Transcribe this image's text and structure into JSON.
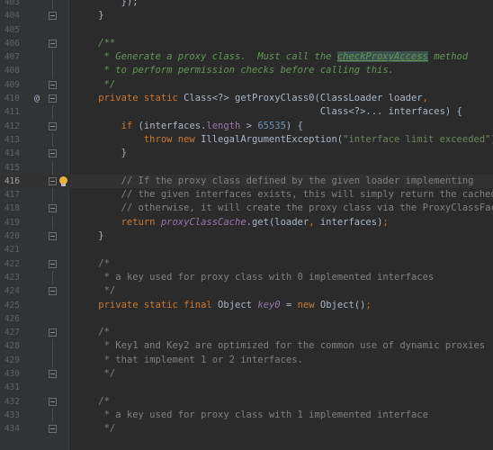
{
  "theme": {
    "background": "#2b2b2b",
    "gutter": "#313335",
    "keyword": "#cc7832",
    "number": "#6897bb",
    "string": "#6a8759",
    "comment": "#808080",
    "doc_comment": "#629755",
    "field": "#9876aa",
    "text": "#a9b7c6"
  },
  "lines": [
    {
      "n": "403",
      "tokens": [
        {
          "c": "plain",
          "t": "        });"
        }
      ],
      "fold": "vline"
    },
    {
      "n": "404",
      "tokens": [
        {
          "c": "plain",
          "t": "    }"
        }
      ],
      "fold": "rect"
    },
    {
      "n": "405",
      "tokens": [],
      "fold": ""
    },
    {
      "n": "406",
      "tokens": [
        {
          "c": "dc",
          "t": "    /**"
        }
      ],
      "fold": "rect"
    },
    {
      "n": "407",
      "tokens": [
        {
          "c": "dc",
          "t": "     * Generate a proxy class.  Must call the "
        },
        {
          "c": "dc-hl",
          "t": "checkProxyAccess"
        },
        {
          "c": "dc",
          "t": " method"
        }
      ],
      "fold": "vline"
    },
    {
      "n": "408",
      "tokens": [
        {
          "c": "dc",
          "t": "     * to perform permission checks before calling this."
        }
      ],
      "fold": "vline"
    },
    {
      "n": "409",
      "tokens": [
        {
          "c": "dc",
          "t": "     */"
        }
      ],
      "fold": "rect"
    },
    {
      "n": "410",
      "mark": "@",
      "tokens": [
        {
          "c": "kw",
          "t": "    private static "
        },
        {
          "c": "plain",
          "t": "Class<?> getProxyClass0(ClassLoader loader"
        },
        {
          "c": "kw",
          "t": ","
        }
      ],
      "fold": "rect"
    },
    {
      "n": "411",
      "tokens": [
        {
          "c": "plain",
          "t": "                                           Class<?>... interfaces) {"
        }
      ],
      "fold": "vline"
    },
    {
      "n": "412",
      "tokens": [
        {
          "c": "kw",
          "t": "        if "
        },
        {
          "c": "plain",
          "t": "(interfaces."
        },
        {
          "c": "field",
          "t": "length"
        },
        {
          "c": "plain",
          "t": " > "
        },
        {
          "c": "num",
          "t": "65535"
        },
        {
          "c": "plain",
          "t": ") {"
        }
      ],
      "fold": "rect"
    },
    {
      "n": "413",
      "tokens": [
        {
          "c": "kw",
          "t": "            throw new "
        },
        {
          "c": "plain",
          "t": "IllegalArgumentException("
        },
        {
          "c": "str",
          "t": "\"interface limit exceeded\""
        },
        {
          "c": "plain",
          "t": ")"
        },
        {
          "c": "kw",
          "t": ";"
        }
      ],
      "fold": "vline"
    },
    {
      "n": "414",
      "tokens": [
        {
          "c": "plain",
          "t": "        }"
        }
      ],
      "fold": "rect"
    },
    {
      "n": "415",
      "tokens": [],
      "fold": "vline"
    },
    {
      "n": "416",
      "current": true,
      "bulb": true,
      "tokens": [
        {
          "c": "cm",
          "t": "        // If the proxy class defined by the given loader implementing"
        }
      ],
      "fold": "rect"
    },
    {
      "n": "417",
      "tokens": [
        {
          "c": "cm",
          "t": "        // the given interfaces exists, this will simply return the cached copy;"
        }
      ],
      "fold": "vline"
    },
    {
      "n": "418",
      "tokens": [
        {
          "c": "cm",
          "t": "        // otherwise, it will create the proxy class via the ProxyClassFactory"
        }
      ],
      "fold": "rect"
    },
    {
      "n": "419",
      "tokens": [
        {
          "c": "kw",
          "t": "        return "
        },
        {
          "c": "sfield",
          "t": "proxyClassCache"
        },
        {
          "c": "plain",
          "t": ".get(loader"
        },
        {
          "c": "kw",
          "t": ", "
        },
        {
          "c": "plain",
          "t": "interfaces)"
        },
        {
          "c": "kw",
          "t": ";"
        }
      ],
      "fold": "vline"
    },
    {
      "n": "420",
      "tokens": [
        {
          "c": "plain",
          "t": "    }"
        }
      ],
      "fold": "rect"
    },
    {
      "n": "421",
      "tokens": [],
      "fold": ""
    },
    {
      "n": "422",
      "tokens": [
        {
          "c": "cm",
          "t": "    /*"
        }
      ],
      "fold": "rect"
    },
    {
      "n": "423",
      "tokens": [
        {
          "c": "cm",
          "t": "     * a key used for proxy class with 0 implemented interfaces"
        }
      ],
      "fold": "vline"
    },
    {
      "n": "424",
      "tokens": [
        {
          "c": "cm",
          "t": "     */"
        }
      ],
      "fold": "rect"
    },
    {
      "n": "425",
      "tokens": [
        {
          "c": "kw",
          "t": "    private static final "
        },
        {
          "c": "plain",
          "t": "Object "
        },
        {
          "c": "sfield",
          "t": "key0"
        },
        {
          "c": "plain",
          "t": " = "
        },
        {
          "c": "kw",
          "t": "new "
        },
        {
          "c": "plain",
          "t": "Object()"
        },
        {
          "c": "kw",
          "t": ";"
        }
      ],
      "fold": ""
    },
    {
      "n": "426",
      "tokens": [],
      "fold": ""
    },
    {
      "n": "427",
      "tokens": [
        {
          "c": "cm",
          "t": "    /*"
        }
      ],
      "fold": "rect"
    },
    {
      "n": "428",
      "tokens": [
        {
          "c": "cm",
          "t": "     * Key1 and Key2 are optimized for the common use of dynamic proxies"
        }
      ],
      "fold": "vline"
    },
    {
      "n": "429",
      "tokens": [
        {
          "c": "cm",
          "t": "     * that implement 1 or 2 interfaces."
        }
      ],
      "fold": "vline"
    },
    {
      "n": "430",
      "tokens": [
        {
          "c": "cm",
          "t": "     */"
        }
      ],
      "fold": "rect"
    },
    {
      "n": "431",
      "tokens": [],
      "fold": ""
    },
    {
      "n": "432",
      "tokens": [
        {
          "c": "cm",
          "t": "    /*"
        }
      ],
      "fold": "rect"
    },
    {
      "n": "433",
      "tokens": [
        {
          "c": "cm",
          "t": "     * a key used for proxy class with 1 implemented interface"
        }
      ],
      "fold": "vline"
    },
    {
      "n": "434",
      "tokens": [
        {
          "c": "cm",
          "t": "     */"
        }
      ],
      "fold": "rect"
    }
  ]
}
